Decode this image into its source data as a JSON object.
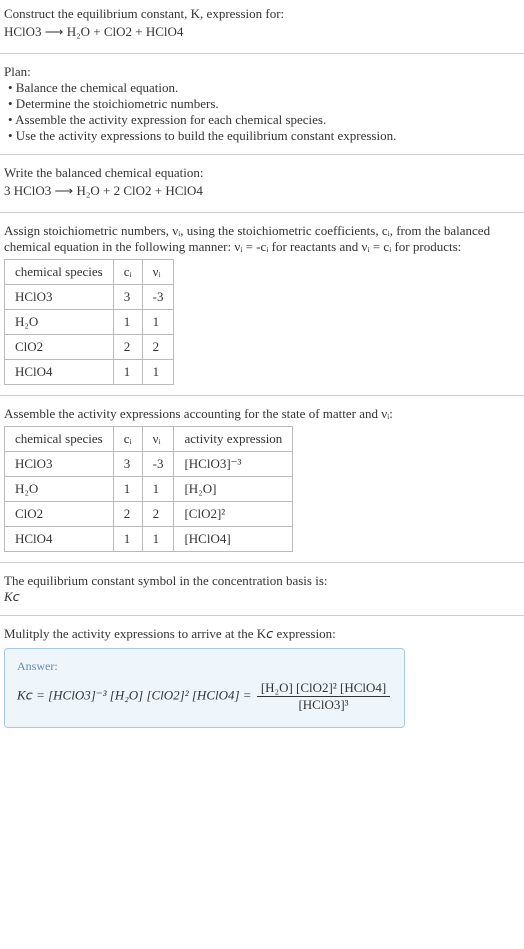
{
  "intro": {
    "line1": "Construct the equilibrium constant, K, expression for:",
    "equation_unbalanced": "HClO3  ⟶  H₂O + ClO2 + HClO4"
  },
  "plan": {
    "heading": "Plan:",
    "items": [
      "• Balance the chemical equation.",
      "• Determine the stoichiometric numbers.",
      "• Assemble the activity expression for each chemical species.",
      "• Use the activity expressions to build the equilibrium constant expression."
    ]
  },
  "balanced": {
    "heading": "Write the balanced chemical equation:",
    "equation": "3 HClO3  ⟶  H₂O + 2 ClO2 + HClO4"
  },
  "stoich": {
    "heading": "Assign stoichiometric numbers, νᵢ, using the stoichiometric coefficients, cᵢ, from the balanced chemical equation in the following manner: νᵢ = -cᵢ for reactants and νᵢ = cᵢ for products:",
    "headers": {
      "species": "chemical species",
      "ci": "cᵢ",
      "vi": "νᵢ"
    },
    "rows": [
      {
        "species": "HClO3",
        "ci": "3",
        "vi": "-3"
      },
      {
        "species": "H₂O",
        "ci": "1",
        "vi": "1"
      },
      {
        "species": "ClO2",
        "ci": "2",
        "vi": "2"
      },
      {
        "species": "HClO4",
        "ci": "1",
        "vi": "1"
      }
    ]
  },
  "activity": {
    "heading": "Assemble the activity expressions accounting for the state of matter and νᵢ:",
    "headers": {
      "species": "chemical species",
      "ci": "cᵢ",
      "vi": "νᵢ",
      "expr": "activity expression"
    },
    "rows": [
      {
        "species": "HClO3",
        "ci": "3",
        "vi": "-3",
        "expr": "[HClO3]⁻³"
      },
      {
        "species": "H₂O",
        "ci": "1",
        "vi": "1",
        "expr": "[H₂O]"
      },
      {
        "species": "ClO2",
        "ci": "2",
        "vi": "2",
        "expr": "[ClO2]²"
      },
      {
        "species": "HClO4",
        "ci": "1",
        "vi": "1",
        "expr": "[HClO4]"
      }
    ]
  },
  "kc_symbol": {
    "heading": "The equilibrium constant symbol in the concentration basis is:",
    "symbol": "K𝘤"
  },
  "multiply": {
    "heading": "Mulitply the activity expressions to arrive at the K𝘤 expression:"
  },
  "answer": {
    "label": "Answer:",
    "lhs": "K𝘤 = [HClO3]⁻³ [H₂O] [ClO2]² [HClO4] = ",
    "numerator": "[H₂O] [ClO2]² [HClO4]",
    "denominator": "[HClO3]³"
  },
  "chart_data": {
    "type": "table",
    "title": "Stoichiometric numbers and activity expressions for 3 HClO3 → H2O + 2 ClO2 + HClO4",
    "columns": [
      "chemical species",
      "c_i",
      "ν_i",
      "activity expression"
    ],
    "rows": [
      [
        "HClO3",
        3,
        -3,
        "[HClO3]^-3"
      ],
      [
        "H2O",
        1,
        1,
        "[H2O]"
      ],
      [
        "ClO2",
        2,
        2,
        "[ClO2]^2"
      ],
      [
        "HClO4",
        1,
        1,
        "[HClO4]"
      ]
    ],
    "equilibrium_constant": "Kc = [H2O][ClO2]^2[HClO4] / [HClO3]^3"
  }
}
